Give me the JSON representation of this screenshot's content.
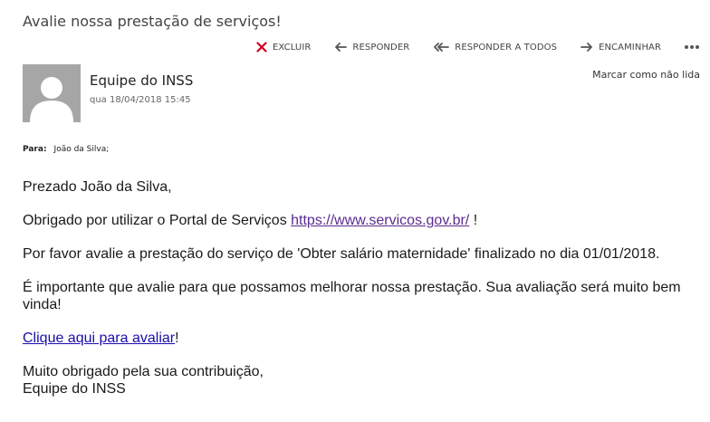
{
  "email": {
    "subject": "Avalie nossa prestação de serviços!",
    "sender": "Equipe do INSS",
    "datetime": "qua 18/04/2018 15:45",
    "to_label": "Para:",
    "to_value": "João da Silva;",
    "mark_unread": "Marcar como não lida"
  },
  "toolbar": {
    "delete": "EXCLUIR",
    "reply": "RESPONDER",
    "reply_all": "RESPONDER A TODOS",
    "forward": "ENCAMINHAR",
    "delete_color": "#d0021b"
  },
  "body": {
    "greeting": "Prezado João da Silva,",
    "thanks_prefix": "Obrigado por utilizar o Portal de Serviços ",
    "portal_link": "https://www.servicos.gov.br/",
    "thanks_suffix": " !",
    "request": "Por favor avalie a prestação do serviço de 'Obter salário maternidade' finalizado no dia 01/01/2018.",
    "importance": "É importante que avalie para que possamos melhorar nossa prestação. Sua avaliação será muito bem vinda!",
    "cta_link": "Clique aqui para avaliar",
    "cta_suffix": "!",
    "closing": "Muito obrigado pela sua contribuição,",
    "signature": "Equipe do INSS"
  }
}
